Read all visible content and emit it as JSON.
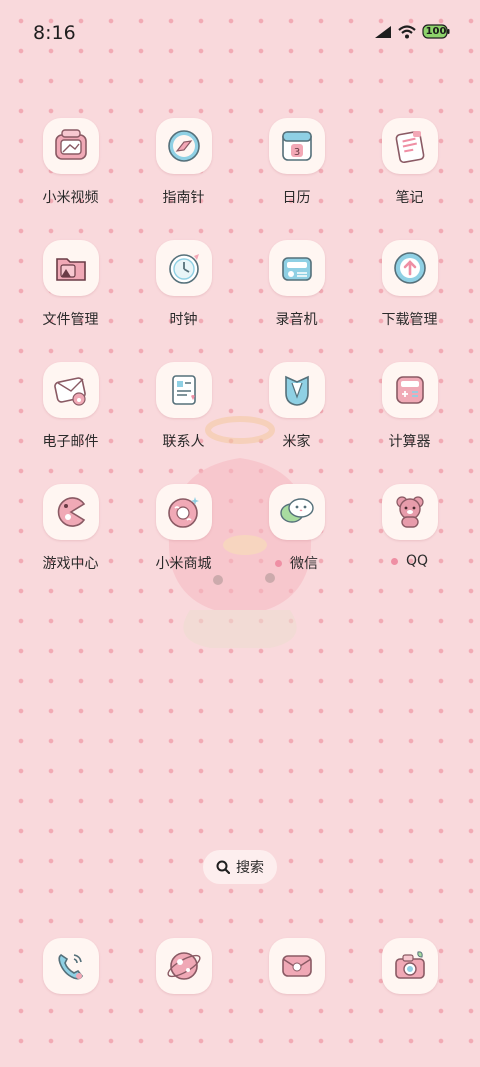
{
  "status_bar": {
    "time": "8:16",
    "battery_level": "100",
    "icons": [
      "signal-icon",
      "wifi-icon",
      "battery-icon"
    ]
  },
  "apps": [
    [
      {
        "label": "小米视频",
        "icon": "video-icon"
      },
      {
        "label": "指南针",
        "icon": "compass-icon"
      },
      {
        "label": "日历",
        "icon": "calendar-icon"
      },
      {
        "label": "笔记",
        "icon": "notes-icon"
      }
    ],
    [
      {
        "label": "文件管理",
        "icon": "folder-icon"
      },
      {
        "label": "时钟",
        "icon": "clock-icon"
      },
      {
        "label": "录音机",
        "icon": "recorder-icon"
      },
      {
        "label": "下载管理",
        "icon": "download-icon"
      }
    ],
    [
      {
        "label": "电子邮件",
        "icon": "mail-icon"
      },
      {
        "label": "联系人",
        "icon": "contacts-icon"
      },
      {
        "label": "米家",
        "icon": "mijia-icon"
      },
      {
        "label": "计算器",
        "icon": "calculator-icon"
      }
    ],
    [
      {
        "label": "游戏中心",
        "icon": "game-icon"
      },
      {
        "label": "小米商城",
        "icon": "shop-icon"
      },
      {
        "label": "微信",
        "icon": "wechat-icon"
      },
      {
        "label": "QQ",
        "icon": "qq-icon"
      }
    ]
  ],
  "calendar_day": "3",
  "search": {
    "label": "搜索"
  },
  "dock": [
    "phone-icon",
    "browser-icon",
    "messages-icon",
    "camera-icon"
  ],
  "colors": {
    "background": "#f9d9dc",
    "dots": "#f2aab4",
    "icon_tile": "#fff6f2",
    "accent_pink": "#ef8fa4",
    "accent_blue": "#7fc8e0"
  }
}
